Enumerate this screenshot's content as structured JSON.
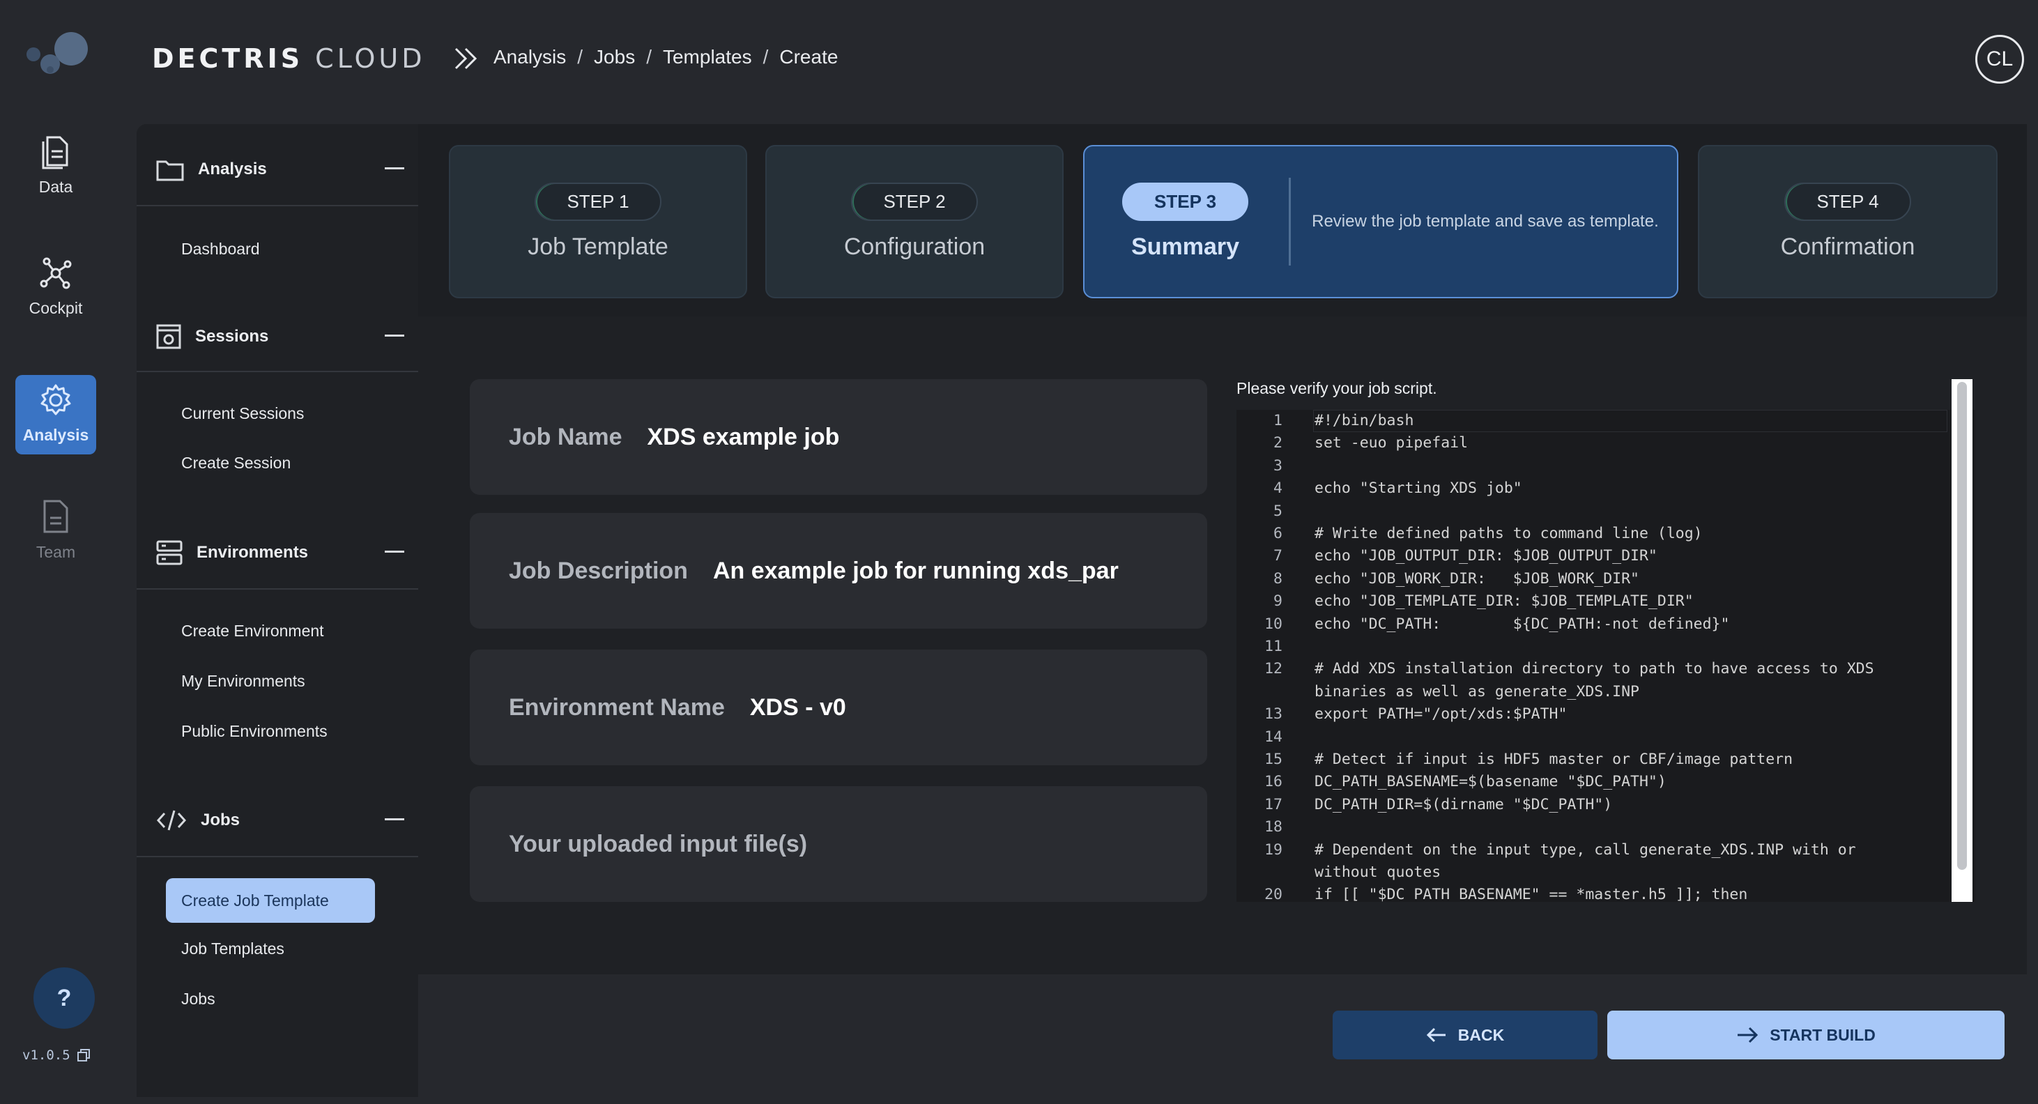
{
  "brand": {
    "part1": "DECTRIS",
    "part2": "CLOUD"
  },
  "breadcrumb": [
    "Analysis",
    "Jobs",
    "Templates",
    "Create"
  ],
  "avatar": {
    "initials": "CL"
  },
  "rail": [
    {
      "label": "Data",
      "icon": "document-icon"
    },
    {
      "label": "Cockpit",
      "icon": "network-icon"
    },
    {
      "label": "Analysis",
      "icon": "gear-icon"
    },
    {
      "label": "Team",
      "icon": "document-icon"
    }
  ],
  "help": {
    "label": "?"
  },
  "version": "v1.0.5",
  "sidebar": {
    "analysis": {
      "title": "Analysis",
      "items": [
        "Dashboard"
      ]
    },
    "sessions": {
      "title": "Sessions",
      "items": [
        "Current Sessions",
        "Create Session"
      ]
    },
    "environments": {
      "title": "Environments",
      "items": [
        "Create Environment",
        "My Environments",
        "Public Environments"
      ]
    },
    "jobs": {
      "title": "Jobs",
      "items": [
        "Create Job Template",
        "Job Templates",
        "Jobs"
      ]
    }
  },
  "steps": [
    {
      "tag": "STEP 1",
      "label": "Job Template"
    },
    {
      "tag": "STEP 2",
      "label": "Configuration"
    },
    {
      "tag": "STEP 3",
      "label": "Summary",
      "description": "Review the job template and save as template."
    },
    {
      "tag": "STEP 4",
      "label": "Confirmation"
    }
  ],
  "summary": {
    "job_name_label": "Job Name",
    "job_name": "XDS example job",
    "job_desc_label": "Job Description",
    "job_desc": "An example job for running xds_par",
    "env_label": "Environment Name",
    "env_name": "XDS - v0",
    "input_label": "Your uploaded input file(s)"
  },
  "script": {
    "label": "Please verify your job script.",
    "lines": [
      {
        "n": "1",
        "t": "#!/bin/bash"
      },
      {
        "n": "2",
        "t": "set -euo pipefail"
      },
      {
        "n": "3",
        "t": ""
      },
      {
        "n": "4",
        "t": "echo \"Starting XDS job\""
      },
      {
        "n": "5",
        "t": ""
      },
      {
        "n": "6",
        "t": "# Write defined paths to command line (log)"
      },
      {
        "n": "7",
        "t": "echo \"JOB_OUTPUT_DIR: $JOB_OUTPUT_DIR\""
      },
      {
        "n": "8",
        "t": "echo \"JOB_WORK_DIR:   $JOB_WORK_DIR\""
      },
      {
        "n": "9",
        "t": "echo \"JOB_TEMPLATE_DIR: $JOB_TEMPLATE_DIR\""
      },
      {
        "n": "10",
        "t": "echo \"DC_PATH:        ${DC_PATH:-not defined}\""
      },
      {
        "n": "11",
        "t": ""
      },
      {
        "n": "12",
        "t": "# Add XDS installation directory to path to have access to XDS"
      },
      {
        "n": "",
        "t": "binaries as well as generate_XDS.INP"
      },
      {
        "n": "13",
        "t": "export PATH=\"/opt/xds:$PATH\""
      },
      {
        "n": "14",
        "t": ""
      },
      {
        "n": "15",
        "t": "# Detect if input is HDF5 master or CBF/image pattern"
      },
      {
        "n": "16",
        "t": "DC_PATH_BASENAME=$(basename \"$DC_PATH\")"
      },
      {
        "n": "17",
        "t": "DC_PATH_DIR=$(dirname \"$DC_PATH\")"
      },
      {
        "n": "18",
        "t": ""
      },
      {
        "n": "19",
        "t": "# Dependent on the input type, call generate_XDS.INP with or"
      },
      {
        "n": "",
        "t": "without quotes"
      },
      {
        "n": "20",
        "t": "if [[ \"$DC_PATH_BASENAME\" == *master.h5 ]]; then"
      }
    ]
  },
  "buttons": {
    "back": "BACK",
    "start": "START BUILD"
  },
  "colors": {
    "accent": "#a8c8f8",
    "active_step": "#1e3f69",
    "background": "#26282d"
  }
}
